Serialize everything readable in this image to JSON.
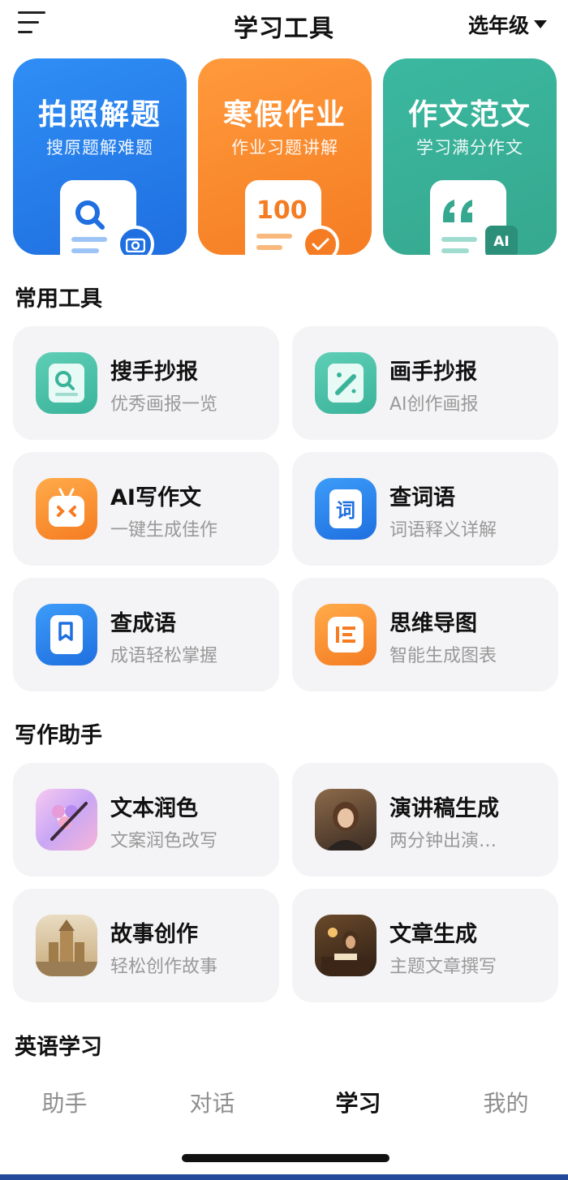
{
  "header": {
    "title": "学习工具",
    "grade_select": "选年级"
  },
  "features": [
    {
      "title": "拍照解题",
      "subtitle": "搜原题解难题",
      "color": "#2f8ef5"
    },
    {
      "title": "寒假作业",
      "subtitle": "作业习题讲解",
      "color": "#ff9a3c",
      "paper_text": "100"
    },
    {
      "title": "作文范文",
      "subtitle": "学习满分作文",
      "color": "#3bb8a0",
      "badge_text": "AI"
    }
  ],
  "sections": {
    "common_tools": "常用工具",
    "writing_assistant": "写作助手",
    "english_learning": "英语学习"
  },
  "common_tools": [
    {
      "name": "搜手抄报",
      "desc": "优秀画报一览",
      "icon": "search-doc-icon"
    },
    {
      "name": "画手抄报",
      "desc": "AI创作画报",
      "icon": "magic-wand-icon"
    },
    {
      "name": "AI写作文",
      "desc": "一键生成佳作",
      "icon": "robot-face-icon"
    },
    {
      "name": "查词语",
      "desc": "词语释义详解",
      "icon": "word-book-icon"
    },
    {
      "name": "查成语",
      "desc": "成语轻松掌握",
      "icon": "bookmark-book-icon"
    },
    {
      "name": "思维导图",
      "desc": "智能生成图表",
      "icon": "mind-map-icon"
    }
  ],
  "writing_tools": [
    {
      "name": "文本润色",
      "desc": "文案润色改写",
      "icon": "flower-pen-image"
    },
    {
      "name": "演讲稿生成",
      "desc": "两分钟出演…",
      "icon": "portrait-image"
    },
    {
      "name": "故事创作",
      "desc": "轻松创作故事",
      "icon": "castle-image"
    },
    {
      "name": "文章生成",
      "desc": "主题文章撰写",
      "icon": "writer-desk-image"
    }
  ],
  "tabs": [
    {
      "label": "助手",
      "active": false
    },
    {
      "label": "对话",
      "active": false
    },
    {
      "label": "学习",
      "active": true
    },
    {
      "label": "我的",
      "active": false
    }
  ]
}
